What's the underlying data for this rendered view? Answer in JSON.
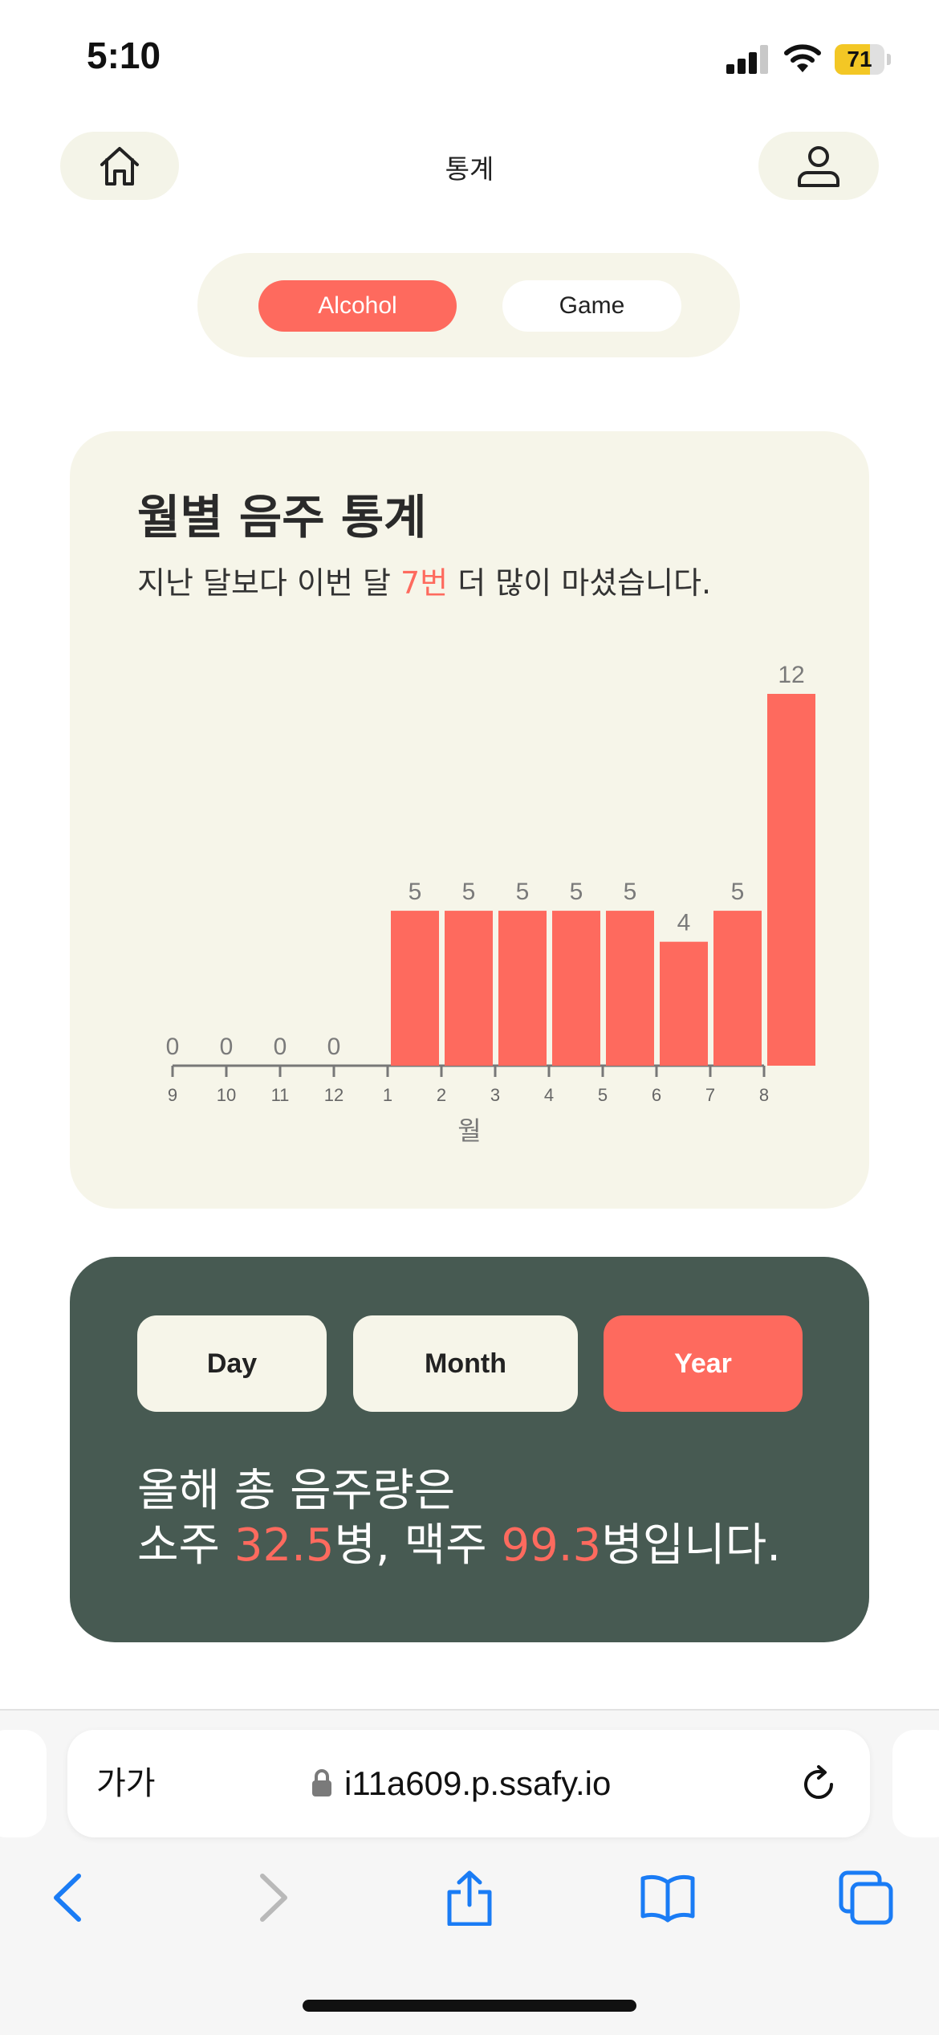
{
  "status_bar": {
    "time": "5:10",
    "battery": "71",
    "battery_level": 0.71
  },
  "header": {
    "title": "통계",
    "home_icon": "home-icon",
    "profile_icon": "user-icon"
  },
  "category_toggle": {
    "options": [
      "Alcohol",
      "Game"
    ],
    "selected": "Alcohol"
  },
  "monthly_card": {
    "title": "월별 음주 통계",
    "subtitle_before": "지난 달보다 이번 달 ",
    "subtitle_highlight": "7번",
    "subtitle_after": " 더 많이 마셨습니다."
  },
  "chart_data": {
    "type": "bar",
    "categories": [
      "9",
      "10",
      "11",
      "12",
      "1",
      "2",
      "3",
      "4",
      "5",
      "6",
      "7",
      "8"
    ],
    "values": [
      0,
      0,
      0,
      0,
      5,
      5,
      5,
      5,
      5,
      4,
      5,
      12
    ],
    "xlabel": "월",
    "ylabel": "",
    "ylim": [
      0,
      12
    ],
    "bar_color": "#fe6a5e",
    "grid": false,
    "data_labels": true
  },
  "summary_card": {
    "periods": [
      "Day",
      "Month",
      "Year"
    ],
    "selected_period": "Year",
    "line1": "올해 총 음주량은",
    "soju_label": "소주 ",
    "soju_value": "32.5",
    "soju_unit": "병, 맥주 ",
    "beer_value": "99.3",
    "beer_unit": "병입니다."
  },
  "browser": {
    "text_size_label": "가가",
    "url": "i11a609.p.ssafy.io",
    "toolbar_icons": [
      "back-icon",
      "forward-icon",
      "share-icon",
      "bookmarks-icon",
      "tabs-icon"
    ]
  },
  "colors": {
    "accent": "#fe6a5e",
    "card_light": "#f6f5e9",
    "card_dark": "#475a52",
    "link_blue": "#1a7cf5"
  }
}
